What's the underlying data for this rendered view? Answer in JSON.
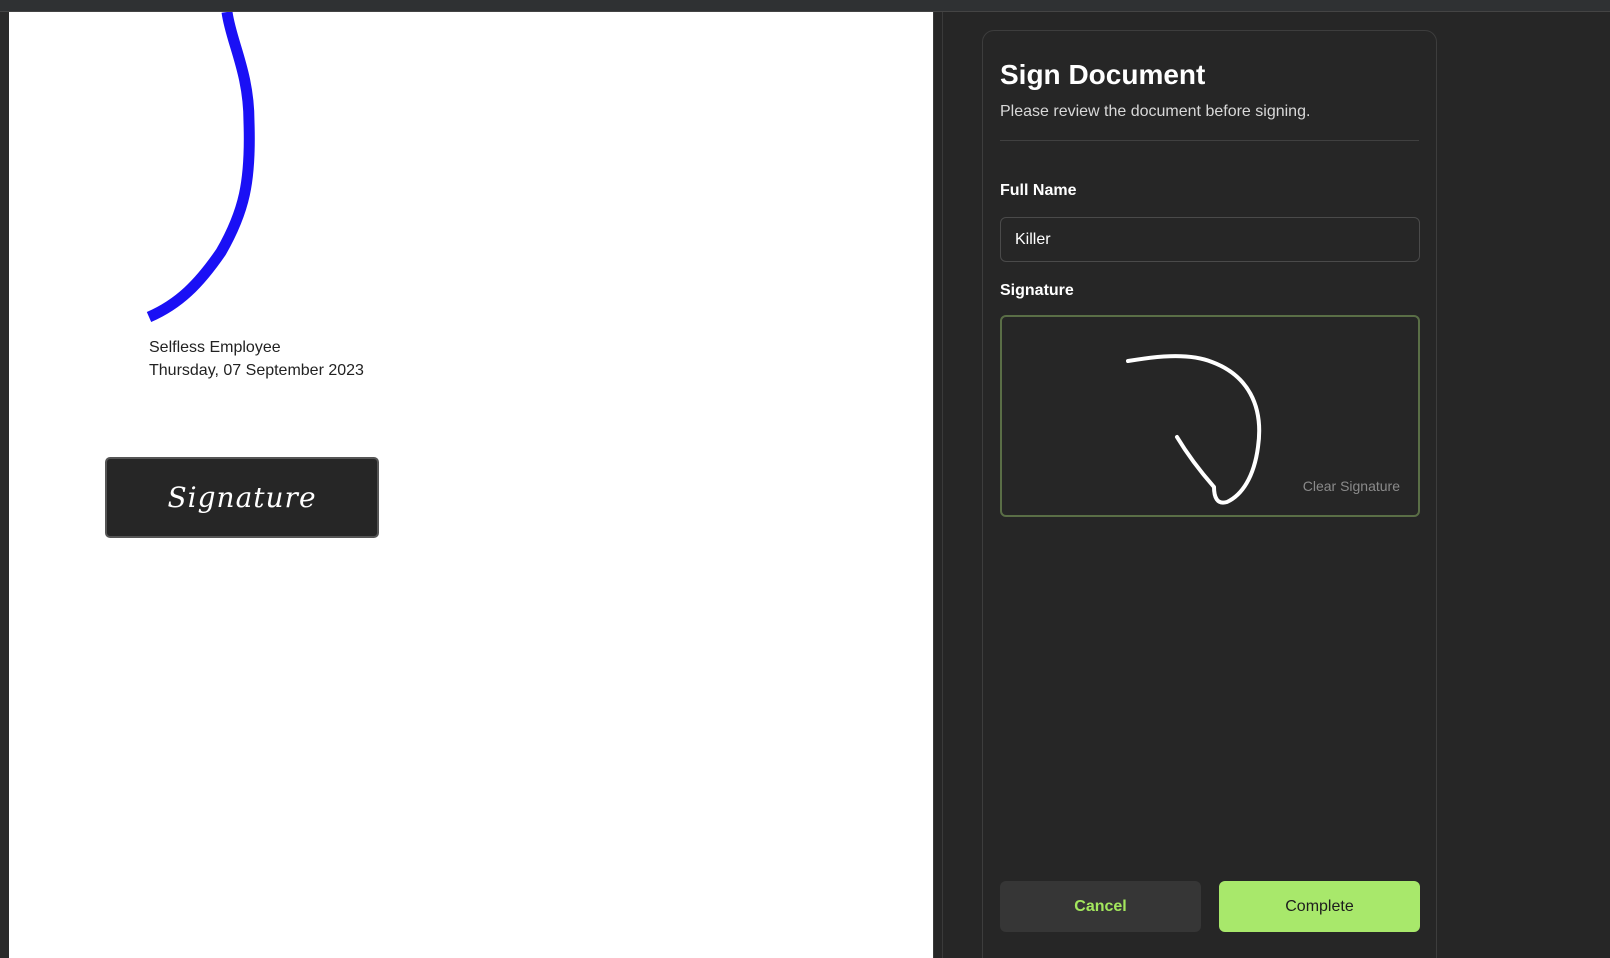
{
  "document": {
    "signer_name": "Selfless Employee",
    "signer_date": "Thursday, 07 September 2023",
    "signature_field_label": "Signature",
    "stroke_color": "#1a10f5"
  },
  "panel": {
    "title": "Sign Document",
    "subtitle": "Please review the document before signing.",
    "full_name_label": "Full Name",
    "full_name_value": "Killer",
    "signature_label": "Signature",
    "clear_signature": "Clear Signature",
    "cancel_label": "Cancel",
    "complete_label": "Complete"
  },
  "colors": {
    "accent": "#a8e86b",
    "panel_bg": "#262626"
  }
}
